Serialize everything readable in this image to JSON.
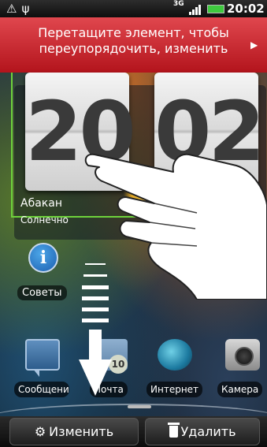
{
  "status_bar": {
    "left_icons": [
      "warning-icon",
      "usb-icon"
    ],
    "network": "3G",
    "time": "20:02",
    "battery_color": "#3ec93e"
  },
  "banner": {
    "line1": "Перетащите элемент, чтобы",
    "line2": "переупорядочить, изменить",
    "color": "#c82b33"
  },
  "clock_widget": {
    "hours": "20",
    "minutes": "02",
    "city": "Абакан",
    "weather": "Солнечно",
    "selection_color": "#6ed23c"
  },
  "tips": {
    "label": "Советы",
    "icon": "info-icon"
  },
  "apps": [
    {
      "label": "Сообщения",
      "icon": "messages-icon"
    },
    {
      "label": "Почта",
      "icon": "mail-icon",
      "badge": "10"
    },
    {
      "label": "Интернет",
      "icon": "globe-icon"
    },
    {
      "label": "Камера",
      "icon": "camera-icon"
    }
  ],
  "bottom_bar": {
    "edit_label": "Изменить",
    "edit_icon": "gear-icon",
    "remove_label": "Удалить",
    "remove_icon": "trash-icon"
  },
  "overlay": {
    "gesture": "drag-down-arrow",
    "hand": "hand-pointer-icon"
  }
}
